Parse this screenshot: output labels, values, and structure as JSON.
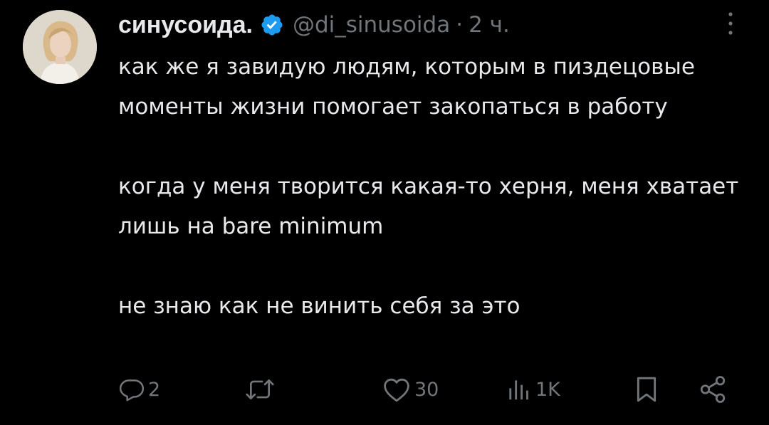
{
  "user": {
    "display_name": "синусоида.",
    "handle": "@di_sinusoida",
    "separator": "·",
    "time": "2 ч.",
    "avatar_icon": "avatar-photo-blonde-woman",
    "verified_icon": "verified-badge-icon",
    "verified_color": "#1d9bf0"
  },
  "tweet": {
    "paragraphs": [
      "как же я завидую людям, которым в пиздецовые моменты жизни помогает закопаться в работу",
      "когда у меня творится какая-то херня, меня хватает лишь на bare minimum",
      "не знаю как не винить себя за это"
    ]
  },
  "actions": {
    "reply": {
      "icon": "reply-bubble-icon",
      "count": "2"
    },
    "retweet": {
      "icon": "retweet-icon"
    },
    "like": {
      "icon": "heart-icon",
      "count": "30"
    },
    "views": {
      "icon": "views-bar-chart-icon",
      "count": "1K"
    },
    "bookmark": {
      "icon": "bookmark-icon"
    },
    "share": {
      "icon": "share-icon"
    }
  },
  "colors": {
    "background": "#000000",
    "text": "#e7e9ea",
    "muted": "#71767b"
  }
}
